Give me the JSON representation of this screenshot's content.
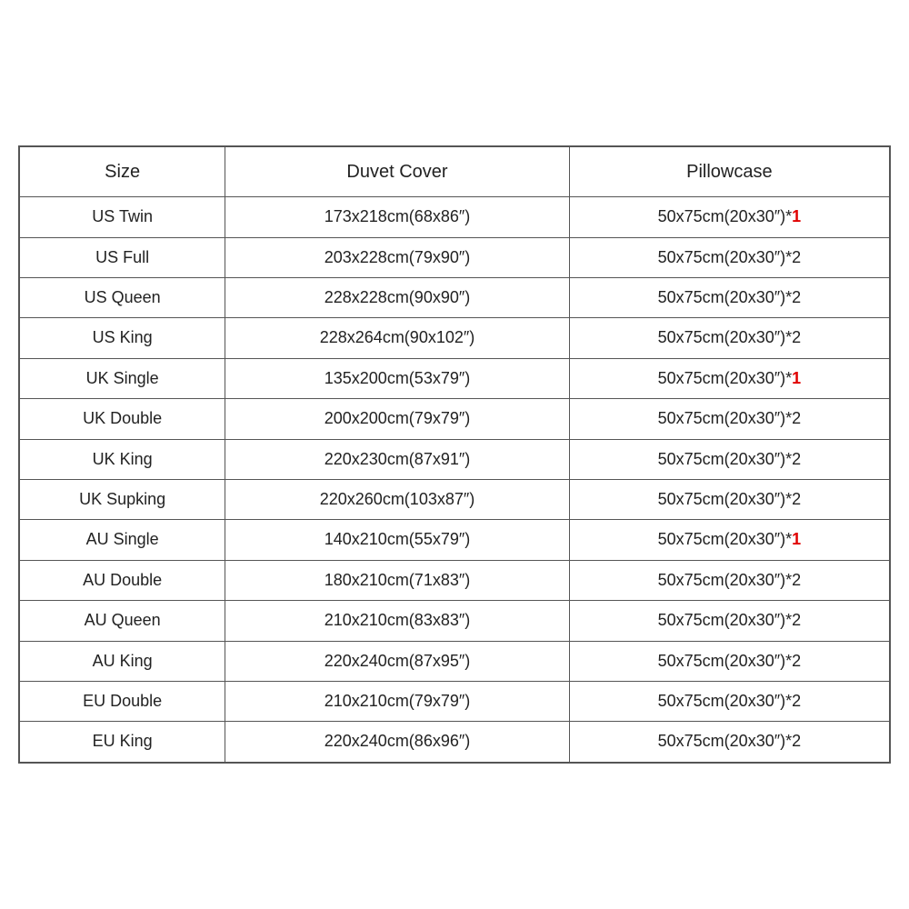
{
  "table": {
    "headers": [
      "Size",
      "Duvet Cover",
      "Pillowcase"
    ],
    "rows": [
      {
        "size": "US Twin",
        "duvet": "173x218cm(68x86″)",
        "pillow_main": "50x75cm(20x30″)*",
        "pillow_suffix": "1",
        "red": true
      },
      {
        "size": "US Full",
        "duvet": "203x228cm(79x90″)",
        "pillow_main": "50x75cm(20x30″)*2",
        "pillow_suffix": "",
        "red": false
      },
      {
        "size": "US Queen",
        "duvet": "228x228cm(90x90″)",
        "pillow_main": "50x75cm(20x30″)*2",
        "pillow_suffix": "",
        "red": false
      },
      {
        "size": "US King",
        "duvet": "228x264cm(90x102″)",
        "pillow_main": "50x75cm(20x30″)*2",
        "pillow_suffix": "",
        "red": false
      },
      {
        "size": "UK Single",
        "duvet": "135x200cm(53x79″)",
        "pillow_main": "50x75cm(20x30″)*",
        "pillow_suffix": "1",
        "red": true
      },
      {
        "size": "UK Double",
        "duvet": "200x200cm(79x79″)",
        "pillow_main": "50x75cm(20x30″)*2",
        "pillow_suffix": "",
        "red": false
      },
      {
        "size": "UK King",
        "duvet": "220x230cm(87x91″)",
        "pillow_main": "50x75cm(20x30″)*2",
        "pillow_suffix": "",
        "red": false
      },
      {
        "size": "UK Supking",
        "duvet": "220x260cm(103x87″)",
        "pillow_main": "50x75cm(20x30″)*2",
        "pillow_suffix": "",
        "red": false
      },
      {
        "size": "AU Single",
        "duvet": "140x210cm(55x79″)",
        "pillow_main": "50x75cm(20x30″)*",
        "pillow_suffix": "1",
        "red": true
      },
      {
        "size": "AU Double",
        "duvet": "180x210cm(71x83″)",
        "pillow_main": "50x75cm(20x30″)*2",
        "pillow_suffix": "",
        "red": false
      },
      {
        "size": "AU Queen",
        "duvet": "210x210cm(83x83″)",
        "pillow_main": "50x75cm(20x30″)*2",
        "pillow_suffix": "",
        "red": false
      },
      {
        "size": "AU King",
        "duvet": "220x240cm(87x95″)",
        "pillow_main": "50x75cm(20x30″)*2",
        "pillow_suffix": "",
        "red": false
      },
      {
        "size": "EU Double",
        "duvet": "210x210cm(79x79″)",
        "pillow_main": "50x75cm(20x30″)*2",
        "pillow_suffix": "",
        "red": false
      },
      {
        "size": "EU King",
        "duvet": "220x240cm(86x96″)",
        "pillow_main": "50x75cm(20x30″)*2",
        "pillow_suffix": "",
        "red": false
      }
    ]
  }
}
